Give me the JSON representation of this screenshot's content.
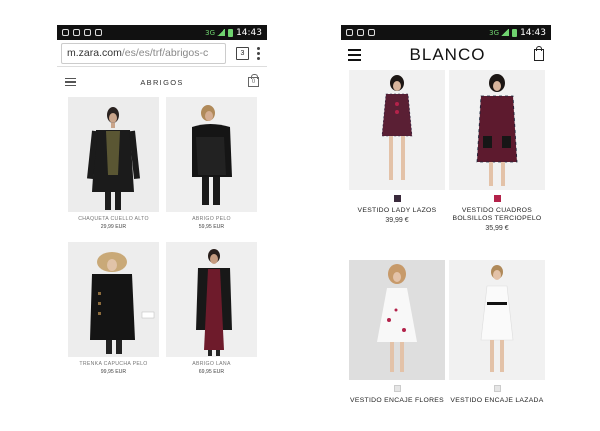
{
  "zara": {
    "status": {
      "network": "3G",
      "time": "14:43"
    },
    "browser": {
      "url_host": "m.zara.com",
      "url_path": "/es/es/trf/abrigos-c",
      "tab_count": "3"
    },
    "header": {
      "title": "ABRIGOS",
      "bag_count": "0"
    },
    "products": [
      {
        "name": "CHAQUETA CUELLO ALTO",
        "price": "29,99 EUR"
      },
      {
        "name": "ABRIGO PELO",
        "price": "59,95 EUR"
      },
      {
        "name": "TRENKA CAPUCHA PELO",
        "price": "99,95 EUR"
      },
      {
        "name": "ABRIGO LANA",
        "price": "69,95 EUR"
      }
    ]
  },
  "blanco": {
    "status": {
      "network": "3G",
      "time": "14:43"
    },
    "header": {
      "logo": "BLANCO"
    },
    "products": [
      {
        "name": "VESTIDO LADY LAZOS",
        "price": "39,99 €",
        "swatches": [
          "#3a2a3c"
        ]
      },
      {
        "name": "VESTIDO CUADROS BOLSILLOS TERCIOPELO",
        "price": "35,99 €",
        "swatches": [
          "#b3224a"
        ]
      },
      {
        "name": "VESTIDO ENCAJE FLORES",
        "price": "",
        "swatches": [
          "#e6e6e6"
        ]
      },
      {
        "name": "VESTIDO ENCAJE LAZADA",
        "price": "",
        "swatches": [
          "#e6e6e6"
        ]
      }
    ]
  },
  "colors": {
    "zara_bg": "#e9e9e9",
    "blanco_bg": "#e4e4e4",
    "status_bar": "#111111",
    "signal": "#6fd36f"
  }
}
